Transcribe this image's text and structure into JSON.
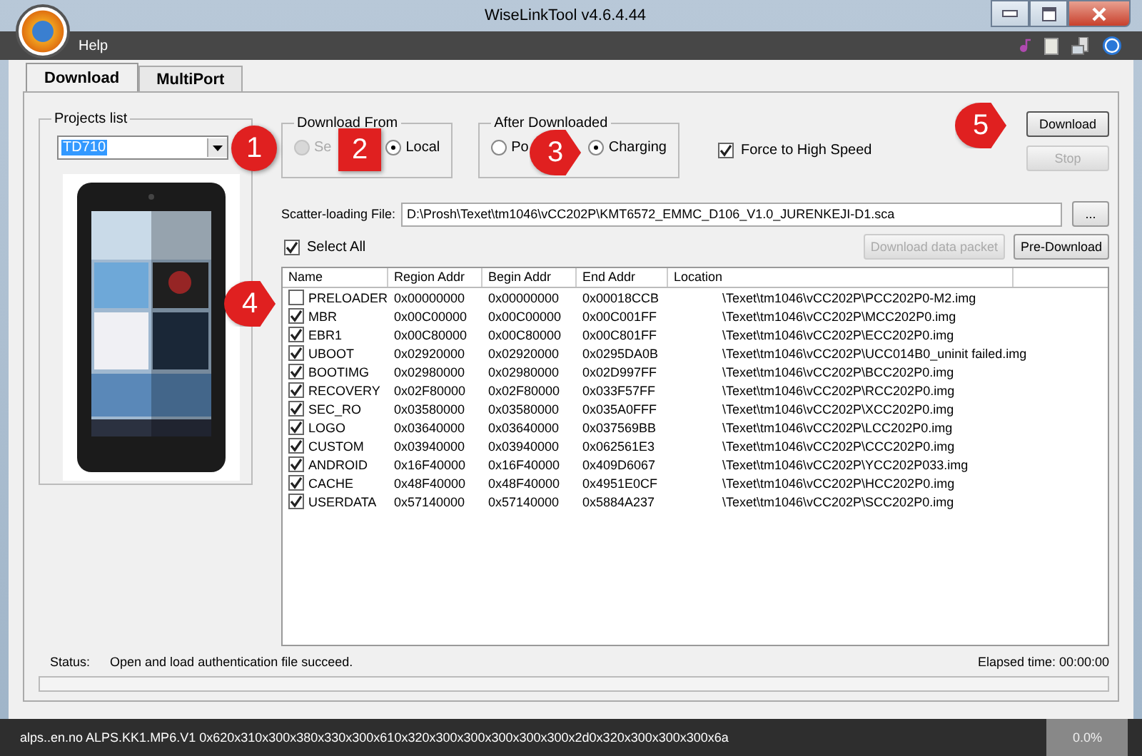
{
  "window": {
    "title": "WiseLinkTool v4.6.4.44"
  },
  "menu": [
    "Help"
  ],
  "tabs": [
    {
      "label": "Download",
      "selected": true
    },
    {
      "label": "MultiPort",
      "selected": false
    }
  ],
  "projects_list": {
    "label": "Projects list",
    "value": "TD710"
  },
  "download_from": {
    "label": "Download From",
    "options": [
      {
        "label": "Se",
        "selected": false,
        "disabled": true
      },
      {
        "label": "Local",
        "selected": true,
        "disabled": false
      }
    ]
  },
  "after_downloaded": {
    "label": "After Downloaded",
    "options": [
      {
        "label": "Po",
        "selected": false
      },
      {
        "label": "Charging",
        "selected": true
      }
    ]
  },
  "force_high_speed": {
    "label": "Force to High Speed",
    "checked": true
  },
  "buttons": [
    {
      "label": "Download",
      "disabled": false
    },
    {
      "label": "Stop",
      "disabled": true
    }
  ],
  "scatter": {
    "label": "Scatter-loading File:",
    "value": "D:\\Prosh\\Texet\\tm1046\\vCC202P\\KMT6572_EMMC_D106_V1.0_JURENKEJI-D1.sca",
    "browse": "..."
  },
  "select_all": {
    "label": "Select All",
    "checked": true
  },
  "table_buttons": [
    {
      "label": "Download data packet",
      "disabled": true
    },
    {
      "label": "Pre-Download",
      "disabled": false
    }
  ],
  "table": {
    "columns": [
      "Name",
      "Region Addr",
      "Begin Addr",
      "End Addr",
      "Location"
    ],
    "rows": [
      {
        "checked": false,
        "cells": [
          "PRELOADER",
          "0x00000000",
          "0x00000000",
          "0x00018CCB",
          "\\Texet\\tm1046\\vCC202P\\PCC202P0-M2.img"
        ]
      },
      {
        "checked": true,
        "cells": [
          "MBR",
          "0x00C00000",
          "0x00C00000",
          "0x00C001FF",
          "\\Texet\\tm1046\\vCC202P\\MCC202P0.img"
        ]
      },
      {
        "checked": true,
        "cells": [
          "EBR1",
          "0x00C80000",
          "0x00C80000",
          "0x00C801FF",
          "\\Texet\\tm1046\\vCC202P\\ECC202P0.img"
        ]
      },
      {
        "checked": true,
        "cells": [
          "UBOOT",
          "0x02920000",
          "0x02920000",
          "0x0295DA0B",
          "\\Texet\\tm1046\\vCC202P\\UCC014B0_uninit failed.img"
        ]
      },
      {
        "checked": true,
        "cells": [
          "BOOTIMG",
          "0x02980000",
          "0x02980000",
          "0x02D997FF",
          "\\Texet\\tm1046\\vCC202P\\BCC202P0.img"
        ]
      },
      {
        "checked": true,
        "cells": [
          "RECOVERY",
          "0x02F80000",
          "0x02F80000",
          "0x033F57FF",
          "\\Texet\\tm1046\\vCC202P\\RCC202P0.img"
        ]
      },
      {
        "checked": true,
        "cells": [
          "SEC_RO",
          "0x03580000",
          "0x03580000",
          "0x035A0FFF",
          "\\Texet\\tm1046\\vCC202P\\XCC202P0.img"
        ]
      },
      {
        "checked": true,
        "cells": [
          "LOGO",
          "0x03640000",
          "0x03640000",
          "0x037569BB",
          "\\Texet\\tm1046\\vCC202P\\LCC202P0.img"
        ]
      },
      {
        "checked": true,
        "cells": [
          "CUSTOM",
          "0x03940000",
          "0x03940000",
          "0x062561E3",
          "\\Texet\\tm1046\\vCC202P\\CCC202P0.img"
        ]
      },
      {
        "checked": true,
        "cells": [
          "ANDROID",
          "0x16F40000",
          "0x16F40000",
          "0x409D6067",
          "\\Texet\\tm1046\\vCC202P\\YCC202P033.img"
        ]
      },
      {
        "checked": true,
        "cells": [
          "CACHE",
          "0x48F40000",
          "0x48F40000",
          "0x4951E0CF",
          "\\Texet\\tm1046\\vCC202P\\HCC202P0.img"
        ]
      },
      {
        "checked": true,
        "cells": [
          "USERDATA",
          "0x57140000",
          "0x57140000",
          "0x5884A237",
          "\\Texet\\tm1046\\vCC202P\\SCC202P0.img"
        ]
      }
    ]
  },
  "status": {
    "label": "Status:",
    "text": "Open and load authentication file succeed.",
    "elapsed": "Elapsed time: 00:00:00",
    "progress": {
      "level": 0
    }
  },
  "status_bar": {
    "text": "alps..en.no ALPS.KK1.MP6.V1 0x620x310x300x380x330x300x610x320x300x300x300x300x300x2d0x320x300x300x300x6a",
    "percent": "0.0%"
  },
  "annotations": [
    {
      "number": "1",
      "kind": "circle"
    },
    {
      "number": "2",
      "kind": "square"
    },
    {
      "number": "3",
      "kind": "pointer"
    },
    {
      "number": "4",
      "kind": "pointer"
    },
    {
      "number": "5",
      "kind": "pointer"
    }
  ]
}
